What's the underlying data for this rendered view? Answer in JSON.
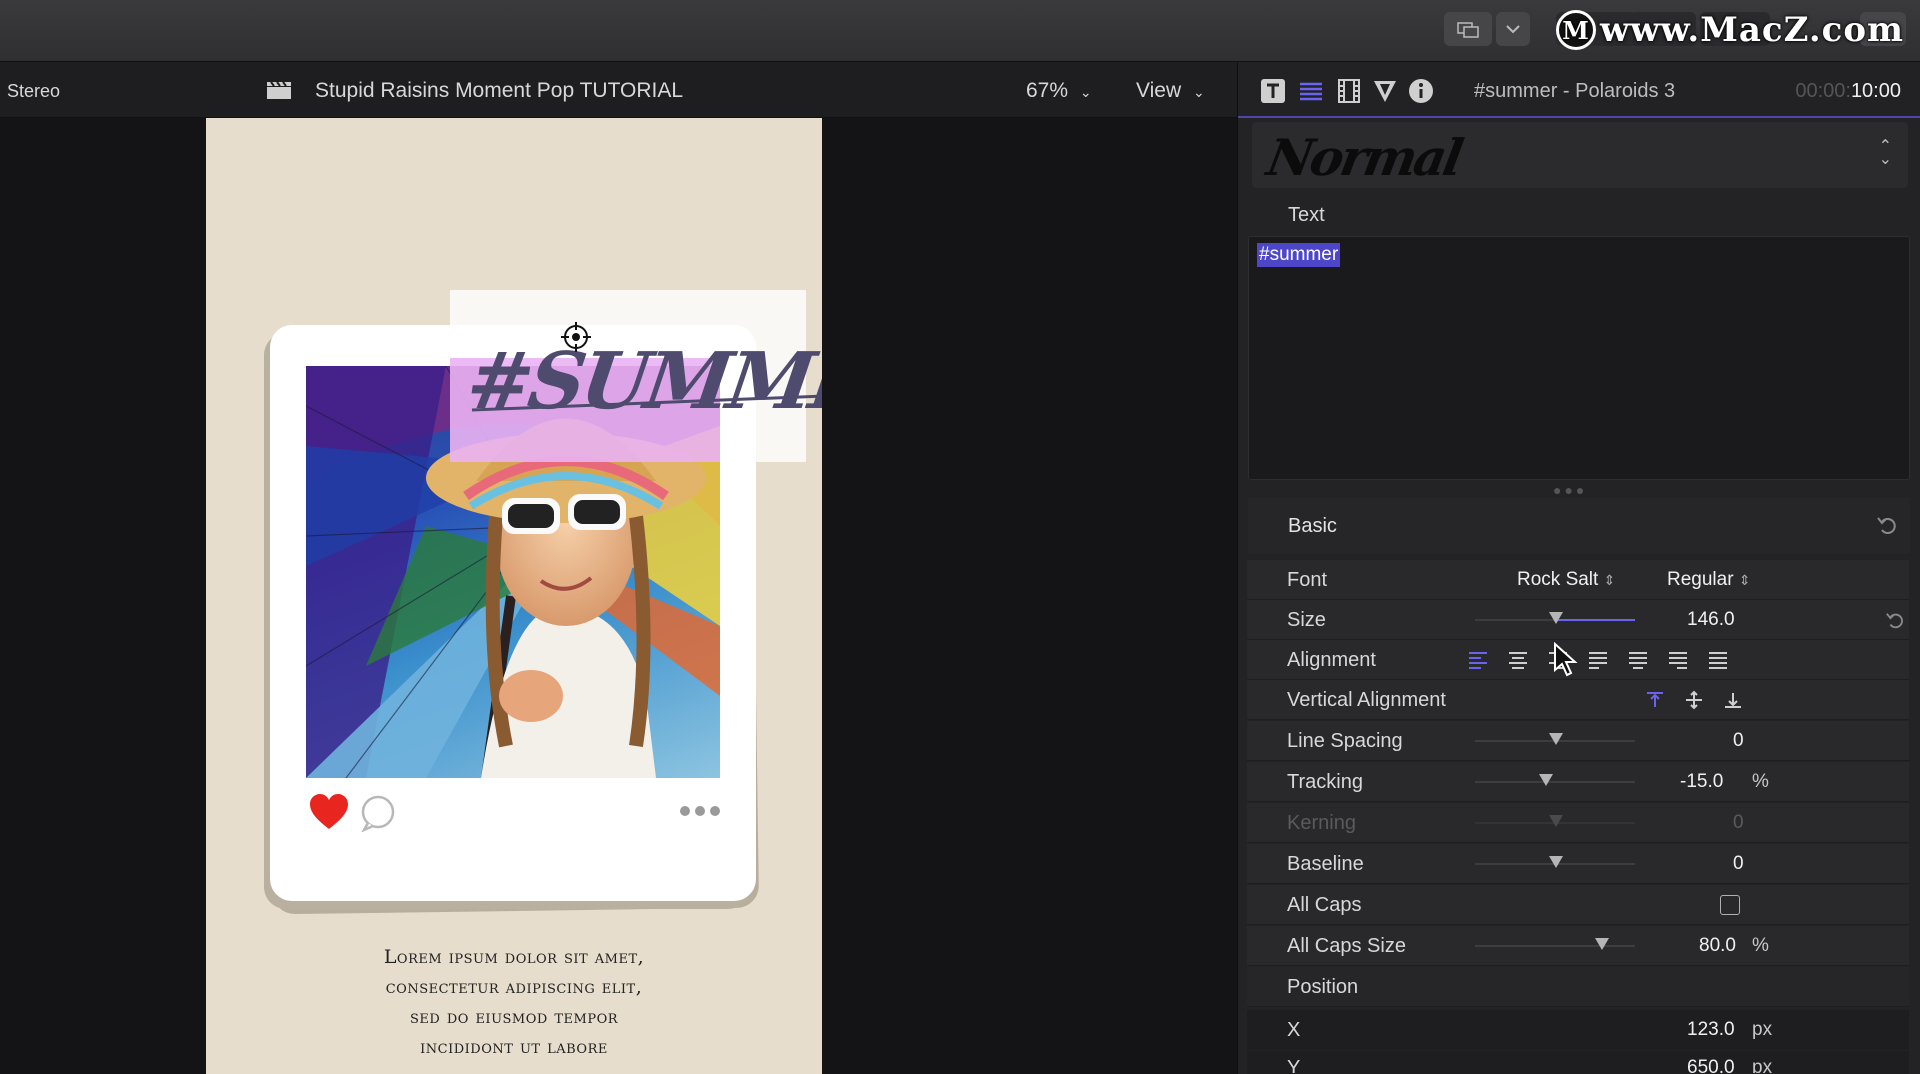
{
  "watermark": {
    "logo_letter": "M",
    "text": "www.MacZ.com"
  },
  "viewer": {
    "audio_mode": "Stereo",
    "project_title": "Stupid Raisins Moment Pop TUTORIAL",
    "zoom": "67%",
    "view_label": "View"
  },
  "canvas": {
    "hashtag_text": "#SUMMER",
    "lorem_lines": [
      "Lorem ipsum dolor sit amet,",
      "consectetur adipiscing elit,",
      "sed do eiusmod tempor",
      "incididont ut labore"
    ]
  },
  "inspector": {
    "title": "#summer - Polaroids 3",
    "timecode_dim": "00:00:",
    "timecode": "10:00",
    "preset": "Normal",
    "text_section_label": "Text",
    "text_value": "#summer",
    "basic_label": "Basic",
    "rows": {
      "font": {
        "label": "Font",
        "family": "Rock Salt",
        "style": "Regular"
      },
      "size": {
        "label": "Size",
        "value": "146.0"
      },
      "alignment": {
        "label": "Alignment"
      },
      "vertical_alignment": {
        "label": "Vertical Alignment"
      },
      "line_spacing": {
        "label": "Line Spacing",
        "value": "0"
      },
      "tracking": {
        "label": "Tracking",
        "value": "-15.0",
        "unit": "%"
      },
      "kerning": {
        "label": "Kerning",
        "value": "0"
      },
      "baseline": {
        "label": "Baseline",
        "value": "0"
      },
      "all_caps": {
        "label": "All Caps",
        "checked": false
      },
      "all_caps_size": {
        "label": "All Caps Size",
        "value": "80.0",
        "unit": "%"
      },
      "position": {
        "label": "Position"
      },
      "x": {
        "label": "X",
        "value": "123.0",
        "unit": "px"
      },
      "y": {
        "label": "Y",
        "value": "650.0",
        "unit": "px"
      }
    }
  },
  "colors": {
    "accent": "#6a62f0",
    "selection": "#4d46c8",
    "canvas_bg": "#e6ddcc",
    "heart": "#e8261f"
  }
}
